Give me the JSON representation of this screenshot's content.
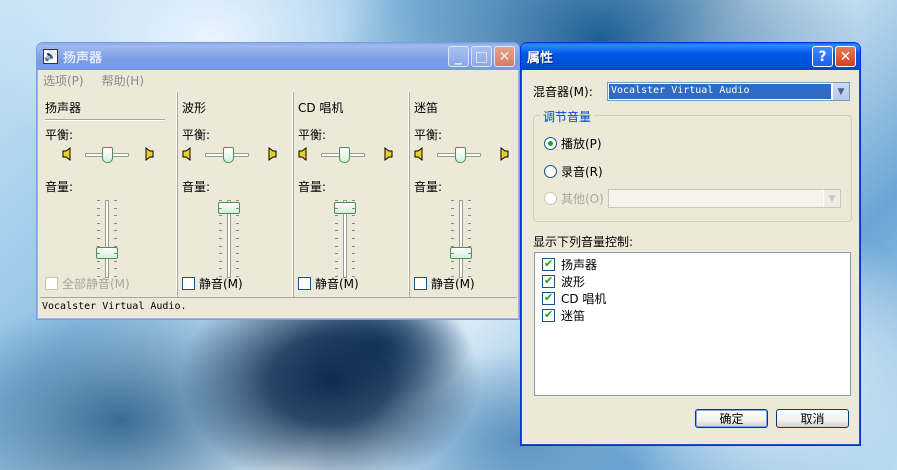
{
  "mixer": {
    "title": "扬声器",
    "menu": [
      "选项(P)",
      "帮助(H)"
    ],
    "balance_label": "平衡:",
    "volume_label": "音量:",
    "channels": [
      {
        "name": "扬声器",
        "mute_label": "全部静音(M)",
        "mute_disabled": true,
        "volume_level": 0.3
      },
      {
        "name": "波形",
        "mute_label": "静音(M)",
        "mute_disabled": false,
        "volume_level": 0.95
      },
      {
        "name": "CD 唱机",
        "mute_label": "静音(M)",
        "mute_disabled": false,
        "volume_level": 0.95
      },
      {
        "name": "迷笛",
        "mute_label": "静音(M)",
        "mute_disabled": false,
        "volume_level": 0.3
      }
    ],
    "status": "Vocalster Virtual Audio."
  },
  "props": {
    "title": "属性",
    "mixer_label": "混音器(M):",
    "mixer_value": "Vocalster Virtual Audio",
    "group_label": "调节音量",
    "radio_playback": "播放(P)",
    "radio_record": "录音(R)",
    "radio_other": "其他(O)",
    "list_label": "显示下列音量控制:",
    "list_items": [
      "扬声器",
      "波形",
      "CD 唱机",
      "迷笛"
    ],
    "ok_label": "确定",
    "cancel_label": "取消"
  },
  "colors": {
    "title_active": "#0058e6",
    "title_inactive": "#7b9de6",
    "dialog_bg": "#ece9d8",
    "groupbox_label": "#0046d5"
  }
}
